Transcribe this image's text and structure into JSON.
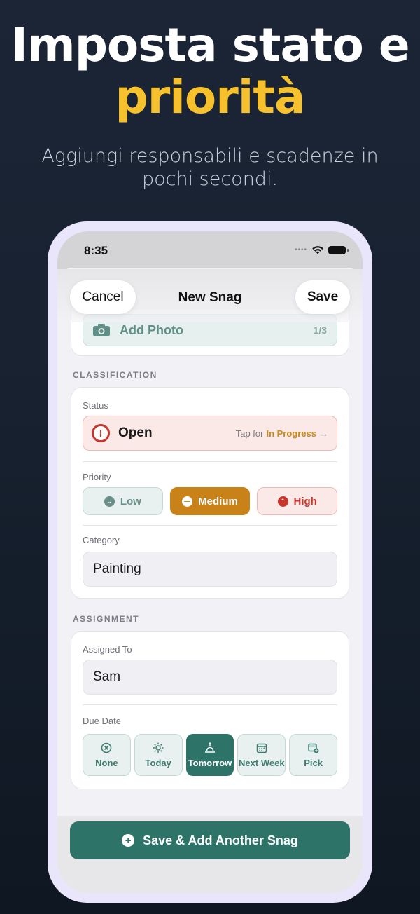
{
  "promo": {
    "headline_line1": "Imposta stato e",
    "headline_accent": "priorità",
    "subtitle": "Aggiungi responsabili e scadenze in pochi secondi."
  },
  "status_bar": {
    "time": "8:35"
  },
  "nav": {
    "cancel_label": "Cancel",
    "title": "New Snag",
    "save_label": "Save"
  },
  "photo": {
    "label": "Add Photo",
    "count": "1/3"
  },
  "classification": {
    "header": "CLASSIFICATION",
    "status_label": "Status",
    "status_value": "Open",
    "status_hint_prefix": "Tap for",
    "status_hint_next": "In Progress",
    "priority_label": "Priority",
    "priority_options": [
      "Low",
      "Medium",
      "High"
    ],
    "priority_selected": "Medium",
    "category_label": "Category",
    "category_value": "Painting"
  },
  "assignment": {
    "header": "ASSIGNMENT",
    "assigned_label": "Assigned To",
    "assigned_value": "Sam",
    "due_label": "Due Date",
    "due_options": [
      "None",
      "Today",
      "Tomorrow",
      "Next Week",
      "Pick"
    ],
    "due_selected": "Tomorrow"
  },
  "bottom": {
    "button_label": "Save & Add Another Snag"
  },
  "colors": {
    "accent_teal": "#2e7368",
    "medium_orange": "#c98218",
    "danger_red": "#c8352a",
    "headline_yellow": "#f6c12d"
  }
}
